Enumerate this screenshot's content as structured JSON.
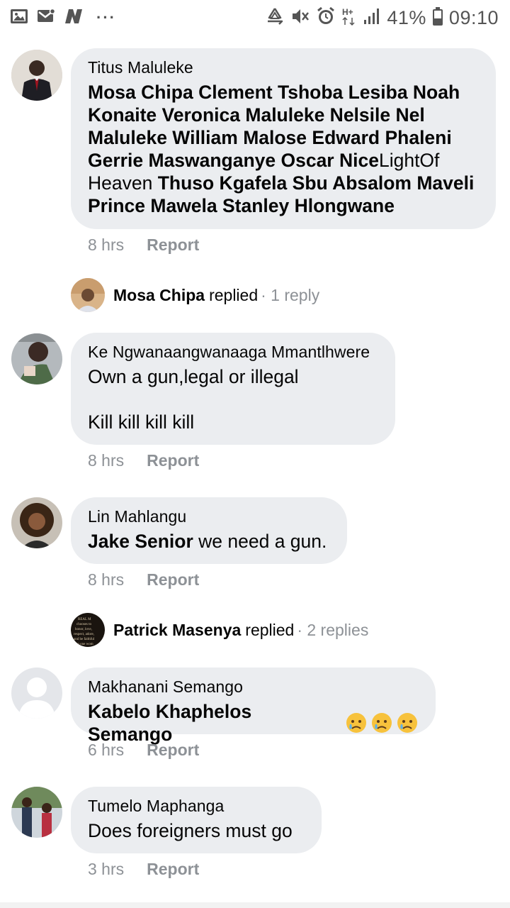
{
  "statusbar": {
    "battery": "41%",
    "time": "09:10",
    "left_icons": [
      "gallery-icon",
      "mail-icon",
      "n-app-icon",
      "more-dots-icon"
    ],
    "right_icons": [
      "recycle-icon",
      "mute-icon",
      "alarm-icon",
      "hplus-data-icon",
      "signal-icon",
      "battery-icon"
    ],
    "more": "···"
  },
  "comments": [
    {
      "author": "Titus Maluleke",
      "segments": [
        {
          "text": "Mosa Chipa Clement Tshoba Lesiba Noah Konaite Veronica Maluleke Nelsile Nel Maluleke William Malose Edward Phaleni Gerrie Maswanganye Oscar Nice",
          "bold": true
        },
        {
          "text": "LightOf Heaven ",
          "bold": false
        },
        {
          "text": "Thuso Kgafela Sbu Absalom Maveli Prince Mawela Stanley Hlongwane",
          "bold": true
        }
      ],
      "time": "8 hrs",
      "report": "Report"
    },
    {
      "author": "Ke Ngwanaangwanaaga Mmantlhwere",
      "line1": "Own a gun,legal or illegal",
      "line2": "Kill kill kill kill",
      "time": "8 hrs",
      "report": "Report"
    },
    {
      "author": "Lin Mahlangu",
      "mention": "Jake Senior",
      "text": " we need a gun.",
      "time": "8 hrs",
      "report": "Report"
    },
    {
      "author": "Makhanani Semango",
      "mention": "Kabelo Khaphelos Semango",
      "emoji": "😥😥😥",
      "time": "6 hrs",
      "report": "Report"
    },
    {
      "author": "Tumelo Maphanga",
      "text": "Does foreigners must go",
      "time": "3 hrs",
      "report": "Report"
    }
  ],
  "replies": [
    {
      "name": "Mosa Chipa",
      "word": "replied",
      "count": "· 1 reply"
    },
    {
      "name": "Patrick Masenya",
      "word": "replied",
      "count": "· 2 replies",
      "avatar_text": "REAL M chooses to honor, love, respect, adore, and be faithful to one wom"
    }
  ],
  "colors": {
    "bubble": "#ebedf0",
    "meta": "#8d9196",
    "text": "#050505"
  }
}
